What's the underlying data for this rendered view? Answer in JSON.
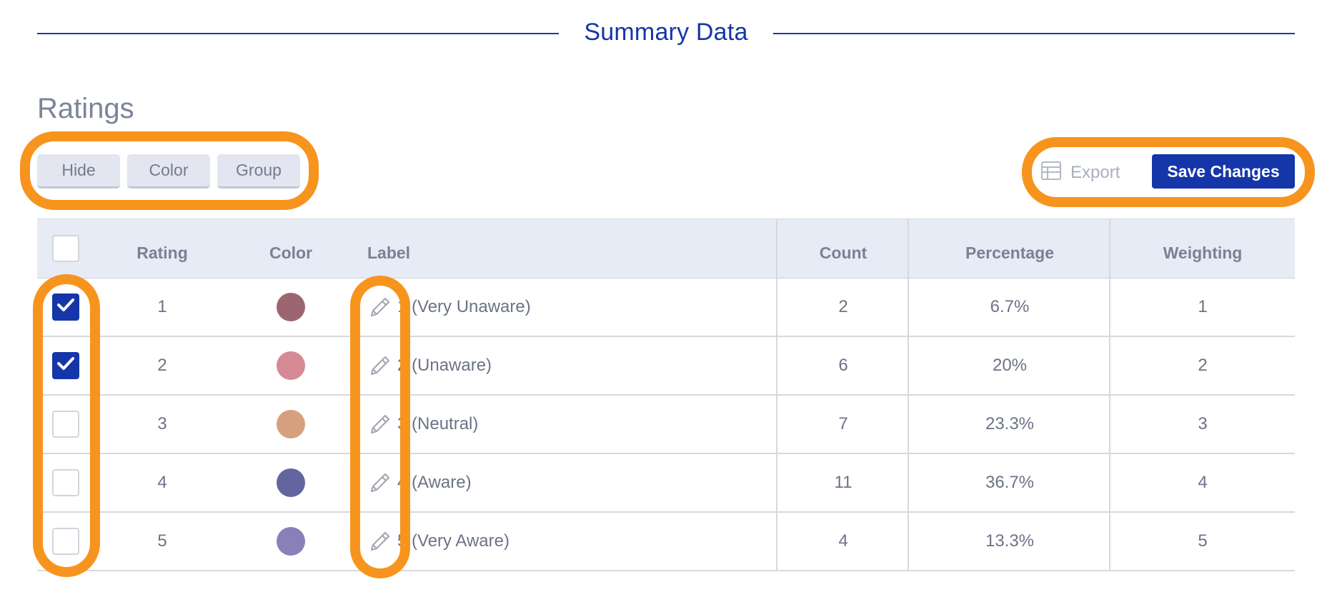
{
  "section": {
    "title": "Summary Data"
  },
  "ratings": {
    "title": "Ratings"
  },
  "toolbar": {
    "hide_label": "Hide",
    "color_label": "Color",
    "group_label": "Group",
    "export_label": "Export",
    "save_label": "Save Changes"
  },
  "table": {
    "headers": {
      "rating": "Rating",
      "color": "Color",
      "label": "Label",
      "count": "Count",
      "percentage": "Percentage",
      "weighting": "Weighting"
    },
    "rows": [
      {
        "checked": true,
        "rating": "1",
        "color": "#9c6670",
        "label": "1 (Very Unaware)",
        "count": "2",
        "percentage": "6.7%",
        "weighting": "1"
      },
      {
        "checked": true,
        "rating": "2",
        "color": "#d68a96",
        "label": "2 (Unaware)",
        "count": "6",
        "percentage": "20%",
        "weighting": "2"
      },
      {
        "checked": false,
        "rating": "3",
        "color": "#d6a07e",
        "label": "3 (Neutral)",
        "count": "7",
        "percentage": "23.3%",
        "weighting": "3"
      },
      {
        "checked": false,
        "rating": "4",
        "color": "#63659e",
        "label": "4 (Aware)",
        "count": "11",
        "percentage": "36.7%",
        "weighting": "4"
      },
      {
        "checked": false,
        "rating": "5",
        "color": "#8a80b8",
        "label": "5 (Very Aware)",
        "count": "4",
        "percentage": "13.3%",
        "weighting": "5"
      }
    ]
  },
  "colors": {
    "brand": "#1536a8",
    "highlight": "#f7941d",
    "header_bg": "#e7ebf6"
  },
  "icons": {
    "export": "table-icon",
    "edit": "pencil-icon",
    "check": "checkmark-icon"
  }
}
